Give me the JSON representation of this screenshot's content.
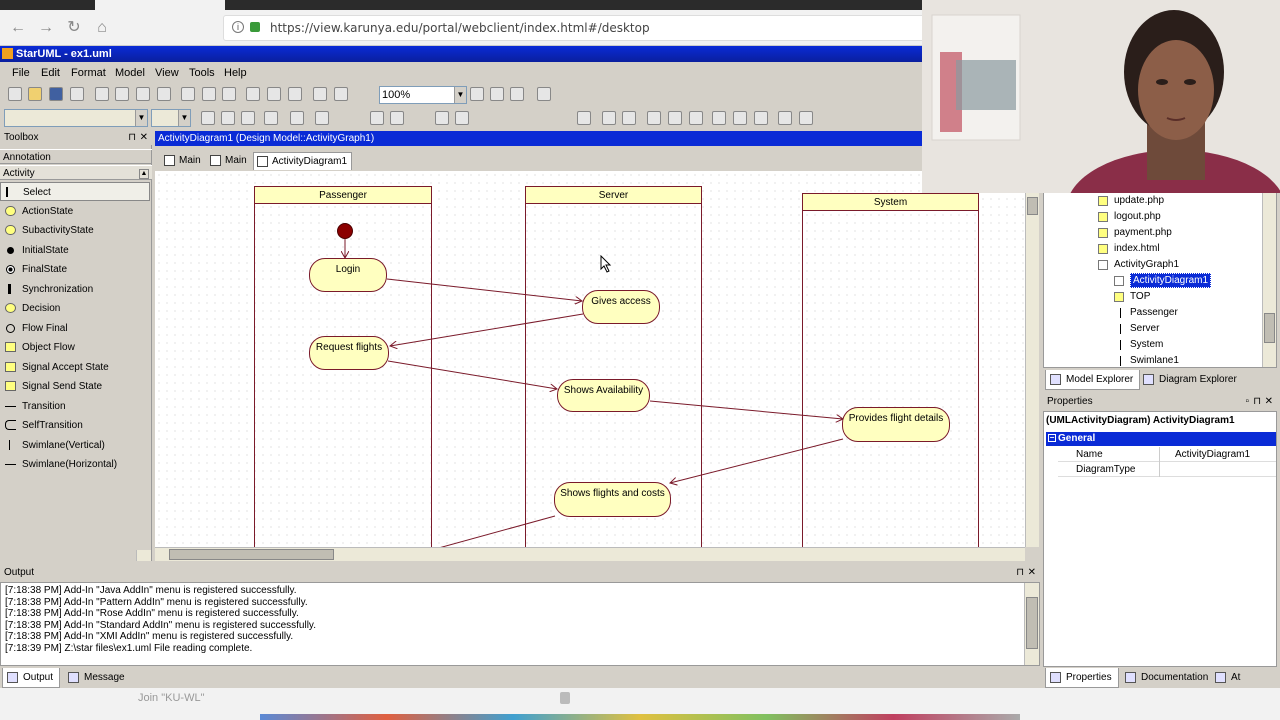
{
  "browser": {
    "url": "https://view.karunya.edu/portal/webclient/index.html#/desktop",
    "status_text": "Join \"KU-WL\""
  },
  "app": {
    "title": "StarUML - ex1.uml",
    "menu": [
      "File",
      "Edit",
      "Format",
      "Model",
      "View",
      "Tools",
      "Help"
    ],
    "zoom": "100%"
  },
  "toolbox": {
    "title": "Toolbox",
    "sections": [
      "Annotation",
      "Activity"
    ],
    "items": [
      "Select",
      "ActionState",
      "SubactivityState",
      "InitialState",
      "FinalState",
      "Synchronization",
      "Decision",
      "Flow Final",
      "Object Flow",
      "Signal Accept State",
      "Signal Send State",
      "Transition",
      "SelfTransition",
      "Swimlane(Vertical)",
      "Swimlane(Horizontal)"
    ]
  },
  "diagram": {
    "title": "ActivityDiagram1 (Design Model::ActivityGraph1)",
    "tabs": [
      "Main",
      "Main",
      "ActivityDiagram1"
    ],
    "swimlanes": [
      "Passenger",
      "Server",
      "System"
    ],
    "actions": [
      "Login",
      "Gives access",
      "Request flights",
      "Shows Availability",
      "Provides flight details",
      "Shows flights and costs"
    ]
  },
  "explorer": {
    "items": [
      "update.php",
      "logout.php",
      "payment.php",
      "index.html",
      "ActivityGraph1",
      "ActivityDiagram1",
      "TOP",
      "Passenger",
      "Server",
      "System",
      "Swimlane1"
    ],
    "tabs": [
      "Model Explorer",
      "Diagram Explorer"
    ]
  },
  "properties": {
    "title": "Properties",
    "header": "(UMLActivityDiagram) ActivityDiagram1",
    "group": "General",
    "rows": [
      {
        "name": "Name",
        "value": "ActivityDiagram1"
      },
      {
        "name": "DiagramType",
        "value": ""
      }
    ],
    "tabs": [
      "Properties",
      "Documentation",
      "At"
    ]
  },
  "output": {
    "title": "Output",
    "lines": [
      "[7:18:38 PM]  Add-In \"Java AddIn\" menu is registered successfully.",
      "[7:18:38 PM]  Add-In \"Pattern AddIn\" menu is registered successfully.",
      "[7:18:38 PM]  Add-In \"Rose AddIn\" menu is registered successfully.",
      "[7:18:38 PM]  Add-In \"Standard AddIn\" menu is registered successfully.",
      "[7:18:38 PM]  Add-In \"XMI AddIn\" menu is registered successfully.",
      "[7:18:39 PM]  Z:\\star files\\ex1.uml File reading complete."
    ],
    "tabs": [
      "Output",
      "Message"
    ]
  }
}
